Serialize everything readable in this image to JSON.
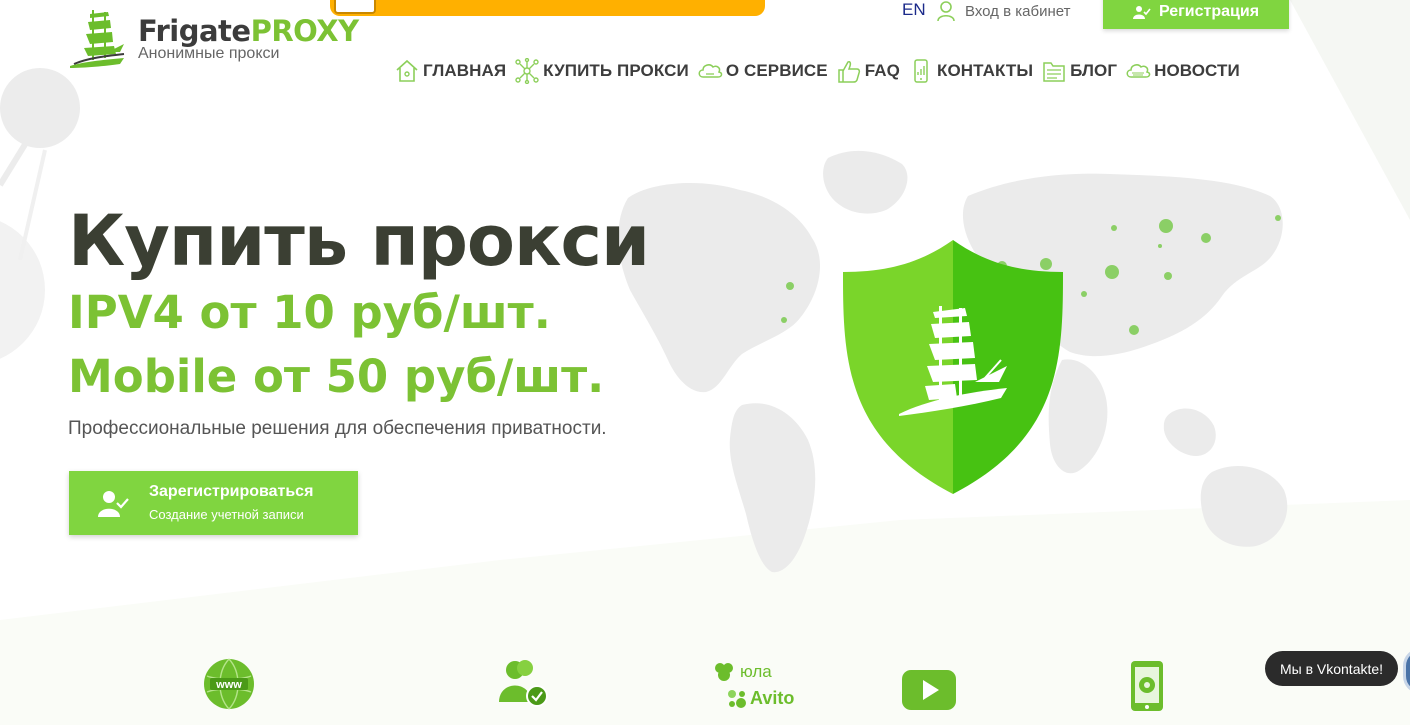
{
  "header": {
    "logo": {
      "name_main": "Frigate",
      "name_accent": "PROXY",
      "subtitle": "Анонимные прокси"
    },
    "lang": "EN",
    "login_label": "Вход в кабинет",
    "register_label": "Регистрация"
  },
  "nav": {
    "items": [
      {
        "label": "ГЛАВНАЯ",
        "icon": "home-icon"
      },
      {
        "label": "КУПИТЬ ПРОКСИ",
        "icon": "network-icon"
      },
      {
        "label": "О СЕРВИСЕ",
        "icon": "cloud-icon"
      },
      {
        "label": "FAQ",
        "icon": "thumbs-up-icon"
      },
      {
        "label": "КОНТАКТЫ",
        "icon": "phone-icon"
      },
      {
        "label": "БЛОГ",
        "icon": "folder-icon"
      },
      {
        "label": "НОВОСТИ",
        "icon": "cloud-news-icon"
      }
    ]
  },
  "hero": {
    "title": "Купить прокси",
    "line1": "IPV4 от 10 руб/шт.",
    "line2": "Mobile от 50 руб/шт.",
    "description": "Профессиональные решения для обеспечения приватности.",
    "cta_title": "Зарегистрироваться",
    "cta_subtitle": "Создание учетной записи"
  },
  "features": {
    "www_label": "www",
    "ula_label": "юла",
    "avito_label": "Avito"
  },
  "vk_label": "Мы в Vkontakte!",
  "colors": {
    "accent": "#7cc234",
    "button": "#80d540",
    "promo": "#ffb000",
    "dark_text": "#3b3f33",
    "lang": "#1b2a8a"
  }
}
